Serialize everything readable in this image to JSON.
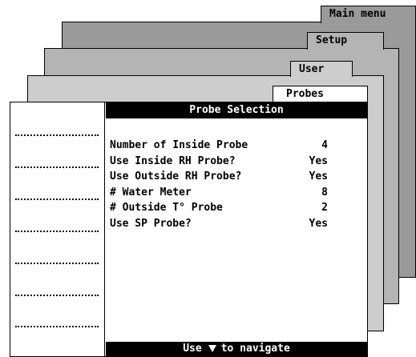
{
  "tabs": {
    "main_menu": "Main menu",
    "setup": "Setup",
    "user": "User",
    "probes": "Probes"
  },
  "screen": {
    "title": "Probe Selection",
    "footer_prefix": "Use",
    "footer_suffix": "to navigate",
    "footer_icon": "down-arrow-icon"
  },
  "settings": [
    {
      "label": "Number of Inside Probe",
      "value": "4"
    },
    {
      "label": "Use Inside RH Probe?",
      "value": "Yes"
    },
    {
      "label": "Use Outside RH Probe?",
      "value": "Yes"
    },
    {
      "label": "# Water Meter",
      "value": "8"
    },
    {
      "label": "# Outside T° Probe",
      "value": "2"
    },
    {
      "label": "Use SP Probe?",
      "value": "Yes"
    }
  ],
  "colors": {
    "layer_main_menu": "#9a9a9a",
    "layer_setup": "#b4b4b4",
    "layer_user": "#cdcdcd",
    "layer_probes": "#e6e6e6",
    "bar": "#000000"
  }
}
